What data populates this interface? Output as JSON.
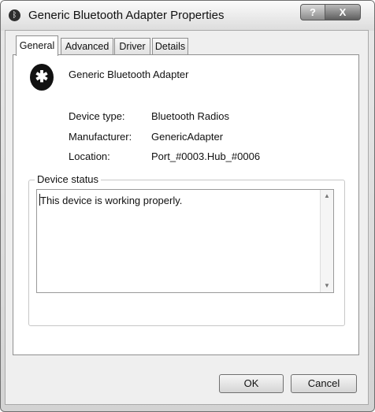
{
  "window": {
    "title": "Generic Bluetooth Adapter Properties",
    "help_label": "?",
    "close_label": "X"
  },
  "tabs": [
    {
      "label": "General",
      "active": true
    },
    {
      "label": "Advanced",
      "active": false
    },
    {
      "label": "Driver",
      "active": false
    },
    {
      "label": "Details",
      "active": false
    }
  ],
  "device": {
    "name": "Generic Bluetooth Adapter",
    "icon": "bluetooth-icon",
    "properties": [
      {
        "label": "Device type:",
        "value": "Bluetooth Radios"
      },
      {
        "label": "Manufacturer:",
        "value": "GenericAdapter"
      },
      {
        "label": "Location:",
        "value": "Port_#0003.Hub_#0006"
      }
    ]
  },
  "status": {
    "title": "Device status",
    "text": "This device is working properly."
  },
  "buttons": {
    "ok": "OK",
    "cancel": "Cancel"
  }
}
